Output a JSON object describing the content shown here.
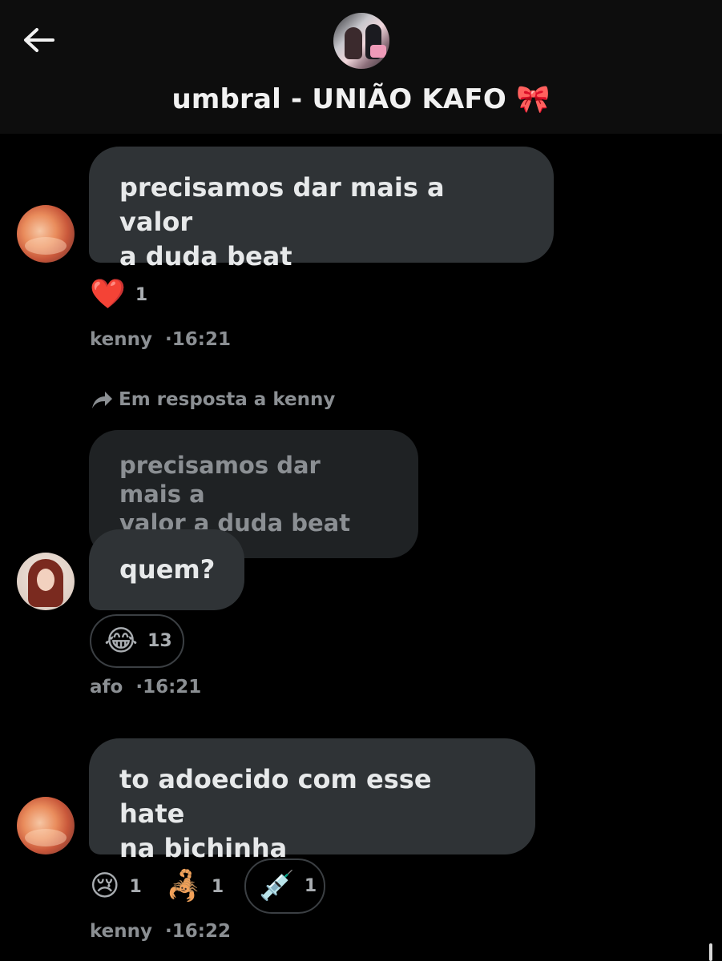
{
  "header": {
    "back_icon": "arrow-left-icon",
    "title": "umbral - UNIÃO KAFO 🎀"
  },
  "messages": [
    {
      "author": "kenny",
      "time": "16:21",
      "text_line1": "precisamos dar mais a valor",
      "text_line2": "a duda beat",
      "reactions": [
        {
          "emoji": "❤️",
          "icon": "heart-icon",
          "count": "1"
        }
      ]
    },
    {
      "author": "afo",
      "time": "16:21",
      "reply_label": "Em resposta a kenny",
      "reply_icon": "reply-arrow-icon",
      "quoted_line1": "precisamos dar mais a",
      "quoted_line2": "valor a duda beat",
      "text": "quem?",
      "reactions": [
        {
          "emoji": "😂",
          "icon": "laughing-face-icon",
          "count": "13"
        }
      ]
    },
    {
      "author": "kenny",
      "time": "16:22",
      "text_line1": "to adoecido com esse hate",
      "text_line2": "na bichinha",
      "reactions": [
        {
          "emoji": "😢",
          "icon": "crying-face-icon",
          "count": "1"
        },
        {
          "emoji": "🦂",
          "icon": "scorpion-icon",
          "count": "1"
        },
        {
          "emoji": "💉",
          "icon": "syringe-icon",
          "count": "1"
        }
      ]
    }
  ],
  "meta_separator": "·"
}
